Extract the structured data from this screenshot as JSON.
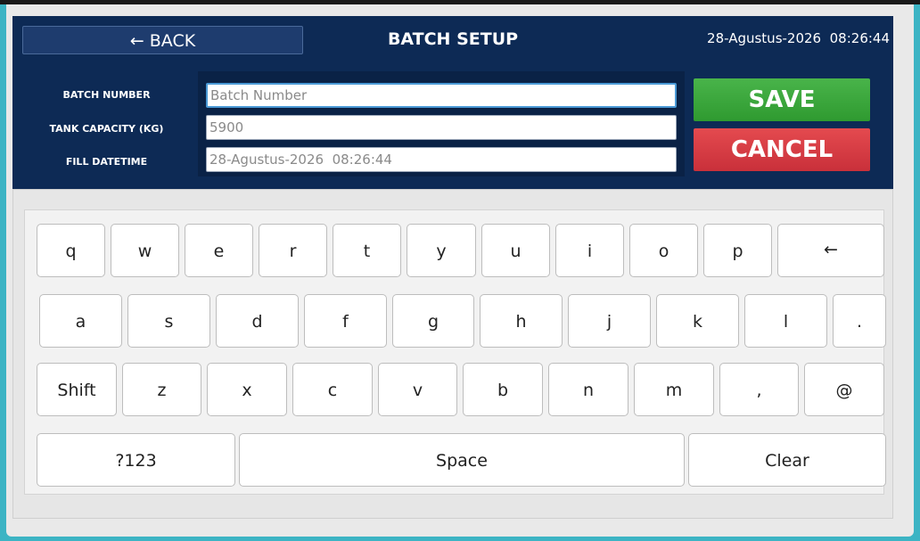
{
  "header": {
    "back_label": "← BACK",
    "title": "BATCH SETUP",
    "datetime": "28-Agustus-2026  08:26:44"
  },
  "form": {
    "batch_number": {
      "label": "BATCH NUMBER",
      "placeholder": "Batch Number",
      "value": ""
    },
    "tank_capacity": {
      "label": "TANK CAPACITY (KG)",
      "value": "5900"
    },
    "fill_datetime": {
      "label": "FILL DATETIME",
      "value": "28-Agustus-2026  08:26:44"
    }
  },
  "actions": {
    "save_label": "SAVE",
    "cancel_label": "CANCEL"
  },
  "colors": {
    "header_bg": "#0d2a55",
    "save": "#3aa63b",
    "cancel": "#d9393f",
    "focus_border": "#4b9ad6"
  },
  "keyboard": {
    "row1": [
      "q",
      "w",
      "e",
      "r",
      "t",
      "y",
      "u",
      "i",
      "o",
      "p"
    ],
    "backspace_label": "←",
    "row2": [
      "a",
      "s",
      "d",
      "f",
      "g",
      "h",
      "j",
      "k",
      "l",
      "."
    ],
    "shift_label": "Shift",
    "row3": [
      "z",
      "x",
      "c",
      "v",
      "b",
      "n",
      "m",
      ",",
      "@"
    ],
    "symbols_label": "?123",
    "space_label": "Space",
    "clear_label": "Clear"
  }
}
